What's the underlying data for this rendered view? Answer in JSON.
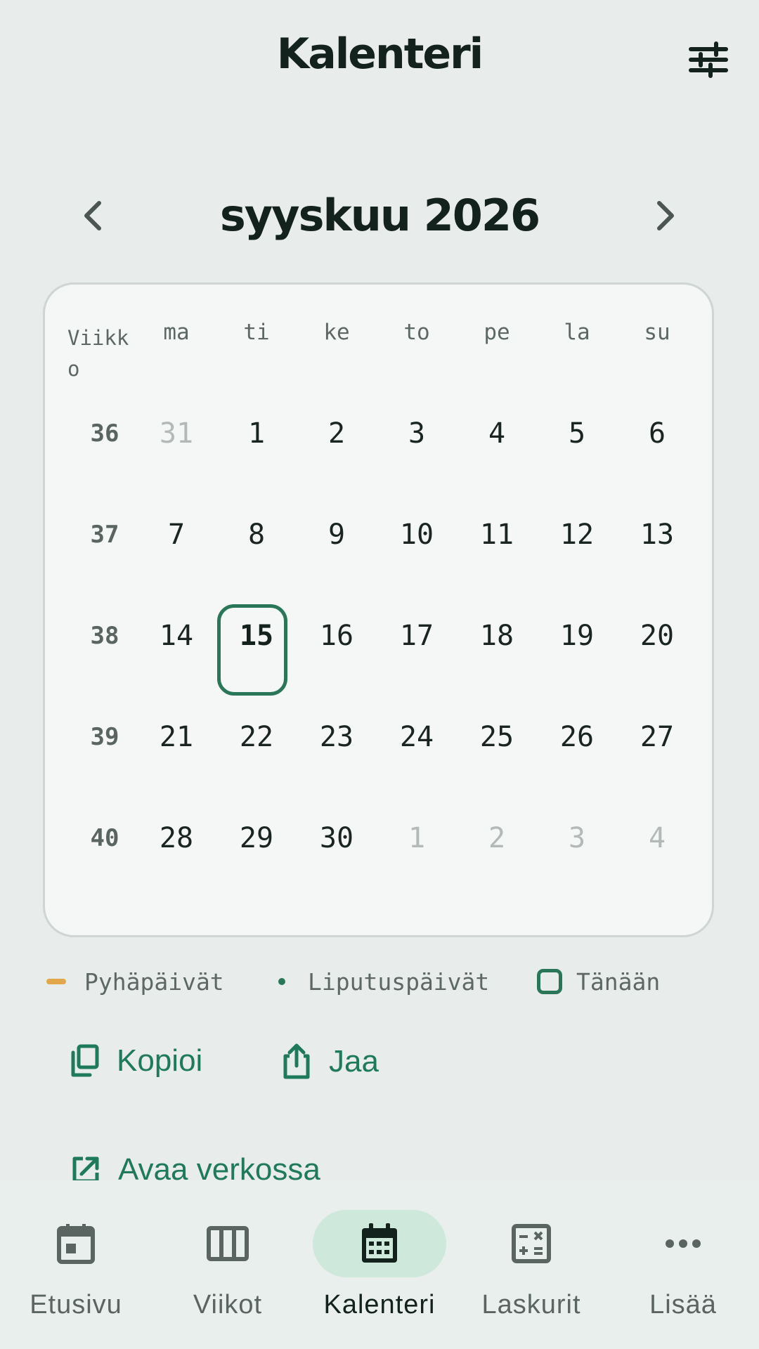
{
  "app_bar": {
    "title": "Kalenteri",
    "filter_icon": "tune-sliders-icon"
  },
  "month_nav": {
    "title": "syyskuu 2026",
    "prev_icon": "chevron-left-icon",
    "next_icon": "chevron-right-icon"
  },
  "calendar": {
    "week_header": "Viikko",
    "weekdays": [
      "ma",
      "ti",
      "ke",
      "to",
      "pe",
      "la",
      "su"
    ],
    "weeks": [
      {
        "week": "36",
        "days": [
          {
            "d": "31",
            "muted": true
          },
          {
            "d": "1"
          },
          {
            "d": "2"
          },
          {
            "d": "3"
          },
          {
            "d": "4"
          },
          {
            "d": "5"
          },
          {
            "d": "6"
          }
        ]
      },
      {
        "week": "37",
        "days": [
          {
            "d": "7"
          },
          {
            "d": "8"
          },
          {
            "d": "9"
          },
          {
            "d": "10"
          },
          {
            "d": "11"
          },
          {
            "d": "12"
          },
          {
            "d": "13"
          }
        ]
      },
      {
        "week": "38",
        "days": [
          {
            "d": "14"
          },
          {
            "d": "15",
            "today": true
          },
          {
            "d": "16"
          },
          {
            "d": "17"
          },
          {
            "d": "18"
          },
          {
            "d": "19"
          },
          {
            "d": "20"
          }
        ]
      },
      {
        "week": "39",
        "days": [
          {
            "d": "21"
          },
          {
            "d": "22"
          },
          {
            "d": "23"
          },
          {
            "d": "24"
          },
          {
            "d": "25"
          },
          {
            "d": "26"
          },
          {
            "d": "27"
          }
        ]
      },
      {
        "week": "40",
        "days": [
          {
            "d": "28"
          },
          {
            "d": "29"
          },
          {
            "d": "30"
          },
          {
            "d": "1",
            "muted": true
          },
          {
            "d": "2",
            "muted": true
          },
          {
            "d": "3",
            "muted": true
          },
          {
            "d": "4",
            "muted": true
          }
        ]
      }
    ]
  },
  "legend": {
    "holidays": "Pyhäpäivät",
    "flag_days": "Liputuspäivät",
    "today": "Tänään"
  },
  "actions": {
    "copy": "Kopioi",
    "share": "Jaa",
    "open_web": "Avaa verkossa"
  },
  "bottom_nav": {
    "tabs": [
      {
        "label": "Etusivu",
        "icon": "home-calendar-icon"
      },
      {
        "label": "Viikot",
        "icon": "columns-icon"
      },
      {
        "label": "Kalenteri",
        "icon": "calendar-month-icon",
        "active": true
      },
      {
        "label": "Laskurit",
        "icon": "calculator-icon"
      },
      {
        "label": "Lisää",
        "icon": "more-horizontal-icon"
      }
    ]
  },
  "colors": {
    "accent": "#2a7658",
    "holiday": "#e2a74a",
    "active_tab_bg": "#cfe8dc"
  }
}
